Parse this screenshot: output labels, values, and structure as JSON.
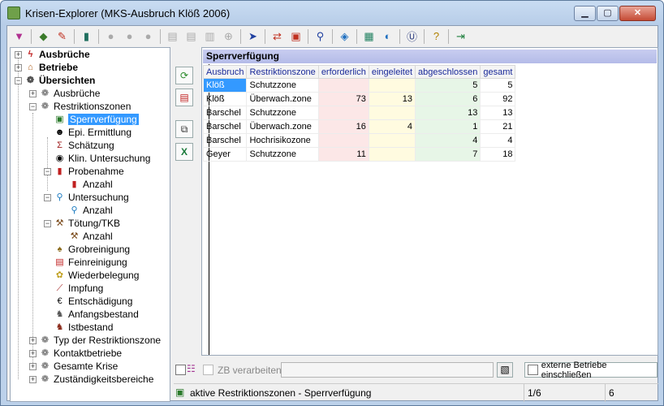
{
  "window": {
    "title": "Krisen-Explorer  (MKS-Ausbruch Klöß 2006)",
    "controls": {
      "minimize": "▁",
      "maximize": "▢",
      "close": "✕"
    }
  },
  "toolbar": {
    "icons": [
      "filter-icon",
      "open-icon",
      "edit-icon",
      "book-icon",
      "globe-icon",
      "fli-icon",
      "world-icon",
      "doc-icon",
      "docs-icon",
      "chart-icon",
      "add-icon",
      "cursor-icon",
      "exchange-icon",
      "car-icon",
      "lookup-icon",
      "diamond-icon",
      "calculator-icon",
      "globe2-icon",
      "u-icon",
      "help-icon",
      "exit-icon"
    ]
  },
  "tree": {
    "items": [
      {
        "label": "Ausbrüche",
        "bold": true,
        "icon": "bolt-icon"
      },
      {
        "label": "Betriebe",
        "bold": true,
        "icon": "house-icon"
      },
      {
        "label": "Übersichten",
        "bold": true,
        "icon": "chart-icon"
      },
      {
        "label": "Ausbrüche",
        "icon": "chart-icon"
      },
      {
        "label": "Restriktionszonen",
        "icon": "chart-icon"
      },
      {
        "label": "Sperrverfügung",
        "icon": "document-icon",
        "selected": true
      },
      {
        "label": "Epi. Ermittlung",
        "icon": "person-icon"
      },
      {
        "label": "Schätzung",
        "icon": "sigma-icon"
      },
      {
        "label": "Klin. Untersuchung",
        "icon": "eye-icon"
      },
      {
        "label": "Probenahme",
        "icon": "tube-icon"
      },
      {
        "label": "Anzahl",
        "icon": "tube-icon"
      },
      {
        "label": "Untersuchung",
        "icon": "magnifier-icon"
      },
      {
        "label": "Anzahl",
        "icon": "magnifier-icon"
      },
      {
        "label": "Tötung/TKB",
        "icon": "hammer-icon"
      },
      {
        "label": "Anzahl",
        "icon": "hammer-icon"
      },
      {
        "label": "Grobreinigung",
        "icon": "broom-icon"
      },
      {
        "label": "Feinreinigung",
        "icon": "bottle-icon"
      },
      {
        "label": "Wiederbelegung",
        "icon": "flower-icon"
      },
      {
        "label": "Impfung",
        "icon": "syringe-icon"
      },
      {
        "label": "Entschädigung",
        "icon": "coin-icon"
      },
      {
        "label": "Anfangsbestand",
        "icon": "animal-icon"
      },
      {
        "label": "Istbestand",
        "icon": "animal-icon"
      },
      {
        "label": "Typ der Restriktionszone",
        "icon": "chart-icon"
      },
      {
        "label": "Kontaktbetriebe",
        "icon": "chart-icon"
      },
      {
        "label": "Gesamte Krise",
        "icon": "chart-icon"
      },
      {
        "label": "Zuständigkeitsbereiche",
        "icon": "chart-icon"
      }
    ]
  },
  "side_buttons": [
    "refresh-icon",
    "print-icon",
    "copy-icon",
    "excel-icon"
  ],
  "grid": {
    "caption": "Sperrverfügung",
    "columns": [
      "Ausbruch",
      "Restriktionszone",
      "erforderlich",
      "eingeleitet",
      "abgeschlossen",
      "gesamt"
    ],
    "rows": [
      [
        "Klöß",
        "Schutzzone",
        "",
        "",
        "5",
        "5"
      ],
      [
        "Klöß",
        "Überwach.zone",
        "73",
        "13",
        "6",
        "92"
      ],
      [
        "Barschel",
        "Schutzzone",
        "",
        "",
        "13",
        "13"
      ],
      [
        "Barschel",
        "Überwach.zone",
        "16",
        "4",
        "1",
        "21"
      ],
      [
        "Barschel",
        "Hochrisikozone",
        "",
        "",
        "4",
        "4"
      ],
      [
        "Geyer",
        "Schutzzone",
        "11",
        "",
        "7",
        "18"
      ]
    ]
  },
  "bottom": {
    "zb_label": "ZB verarbeiten:",
    "zb_value": "",
    "extern_label": "externe Betriebe einschließen"
  },
  "status": {
    "text": "aktive Restriktionszonen - Sperrverfügung",
    "position": "1/6",
    "count": "6"
  },
  "colors": {
    "selection": "#3399ff",
    "required": "#fce7e7",
    "initiated": "#fffbe0",
    "completed": "#e7f6e7"
  }
}
